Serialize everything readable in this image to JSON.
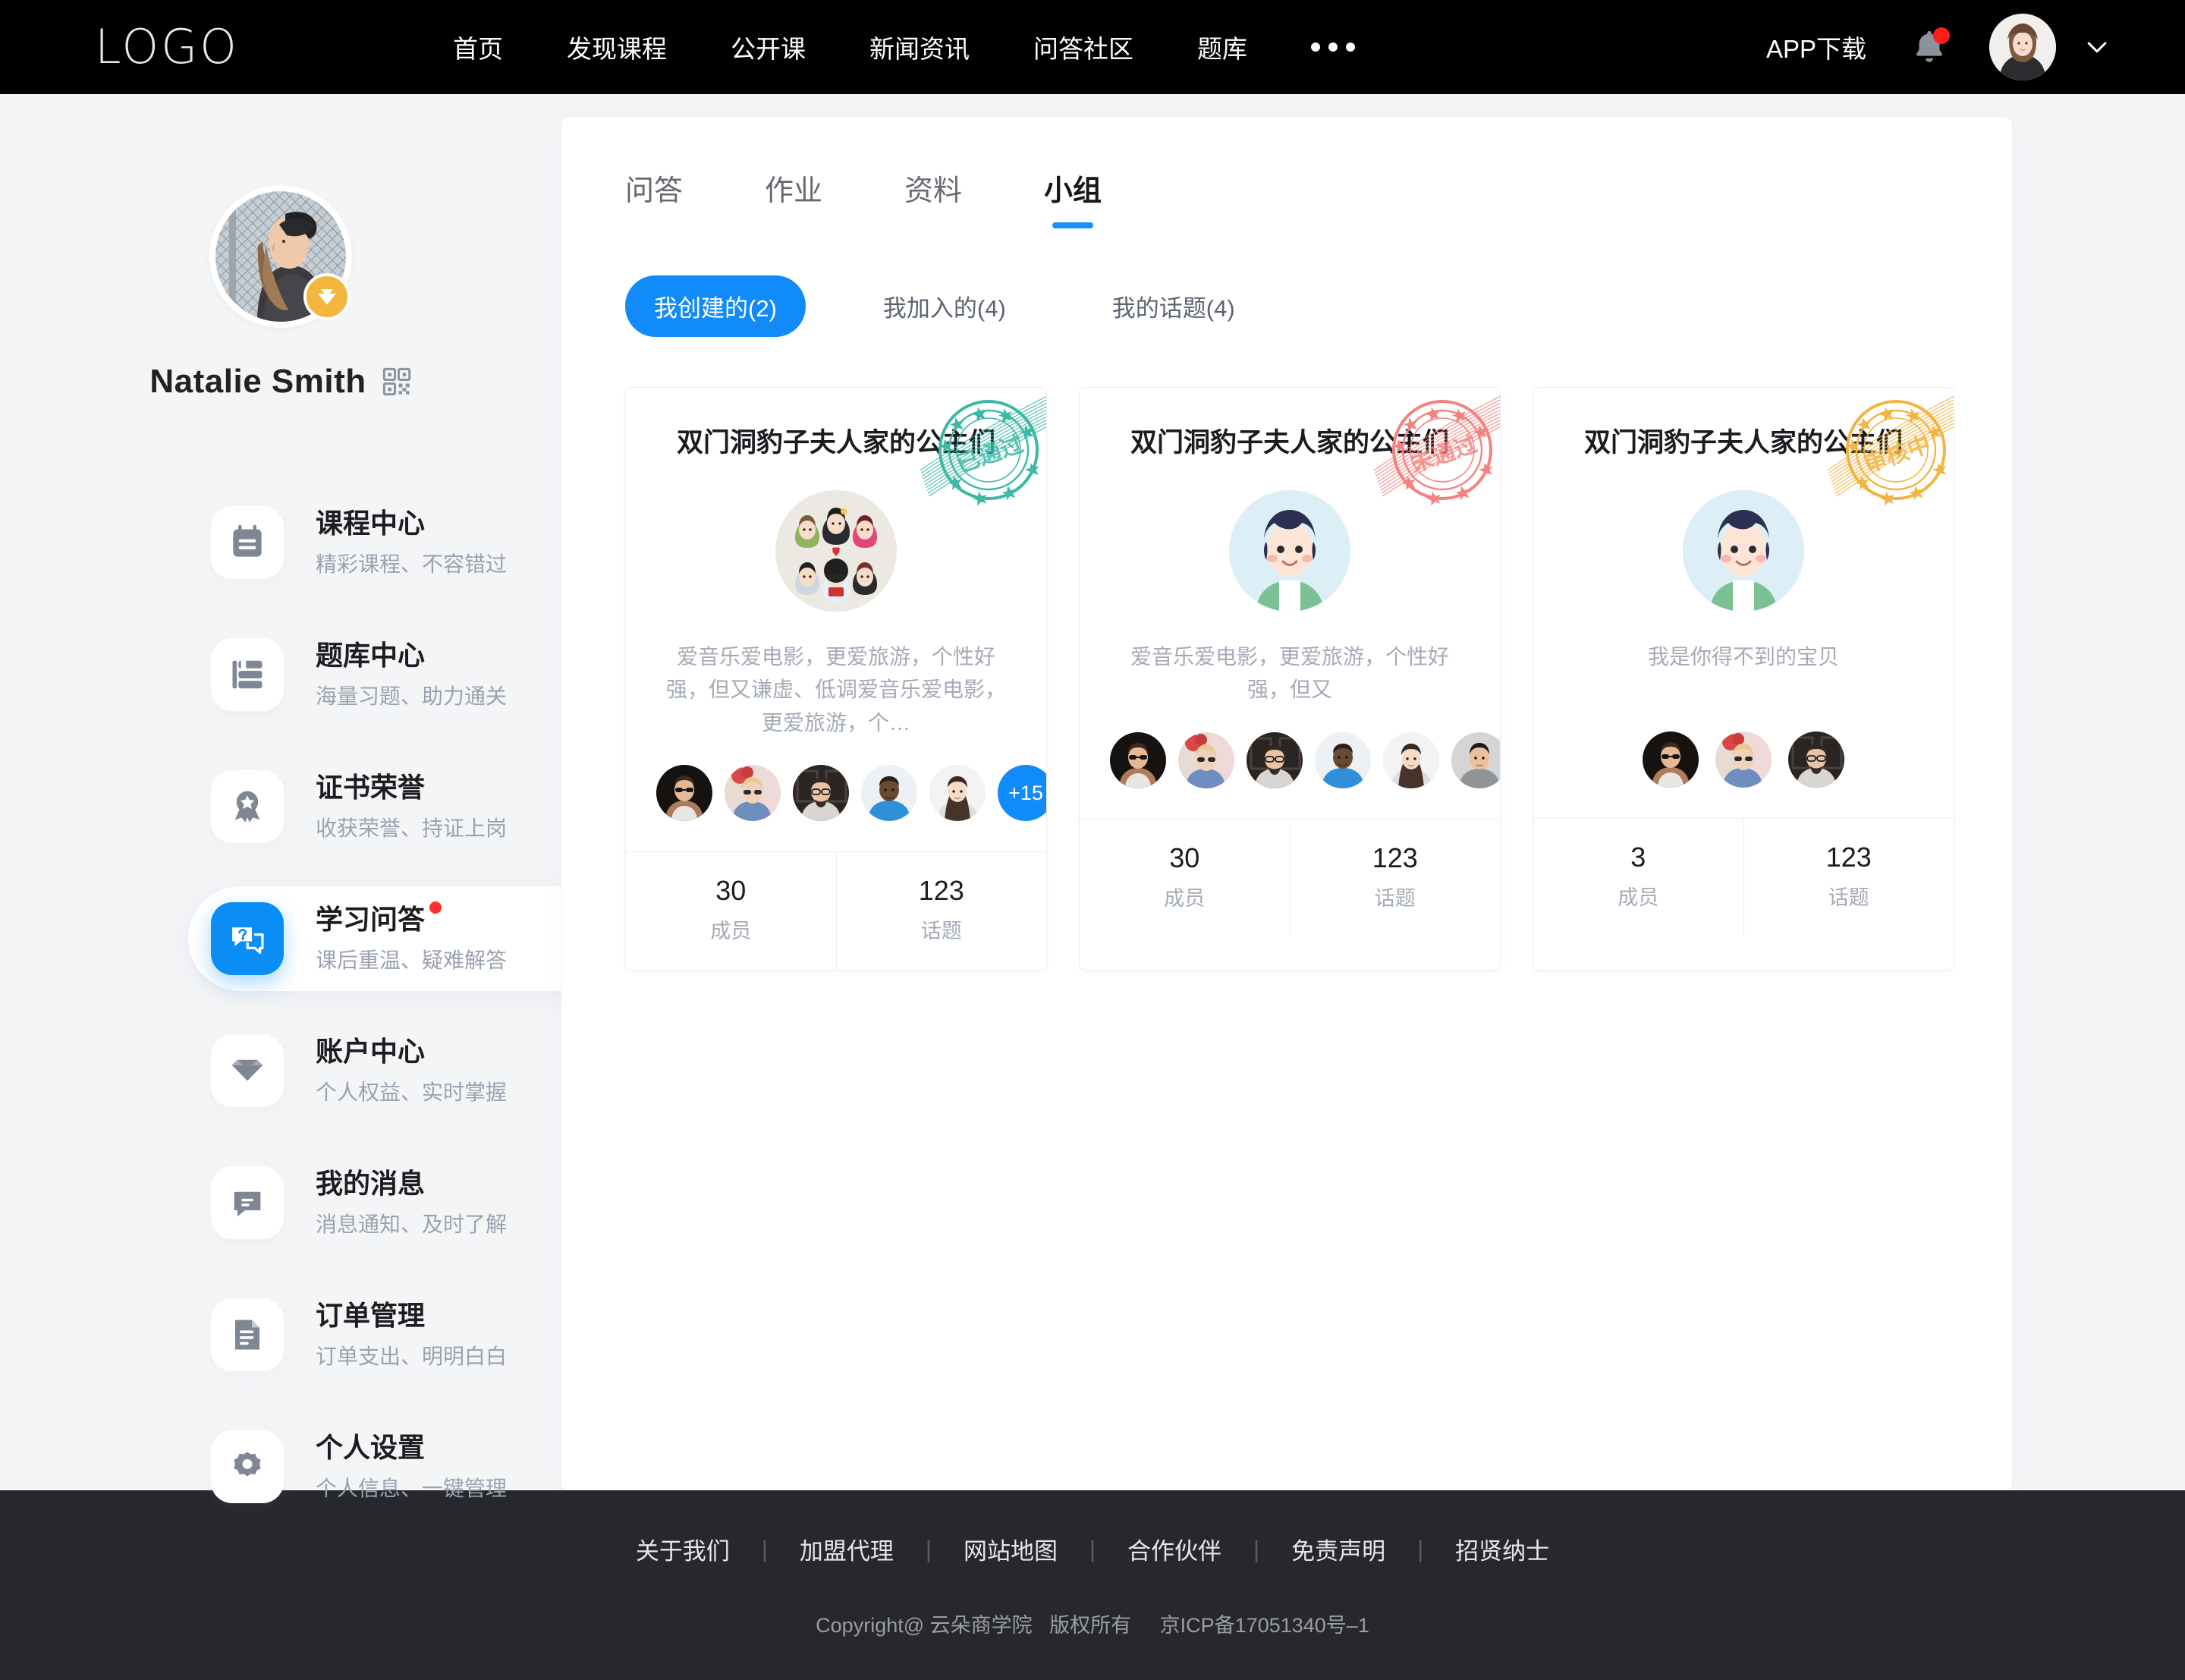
{
  "header": {
    "logo": "LOGO",
    "nav": [
      {
        "label": "首页"
      },
      {
        "label": "发现课程"
      },
      {
        "label": "公开课"
      },
      {
        "label": "新闻资讯"
      },
      {
        "label": "问答社区"
      },
      {
        "label": "题库"
      }
    ],
    "more_icon": "more-horizontal-icon",
    "app_download": "APP下载",
    "bell_icon": "bell-icon",
    "has_notification": true,
    "avatar_icon": "user-avatar",
    "chevron_icon": "chevron-down-icon"
  },
  "sidebar": {
    "user_name": "Natalie Smith",
    "qr_icon": "qr-code-icon",
    "vip_badge_icon": "diamond-icon",
    "items": [
      {
        "title": "课程中心",
        "sub": "精彩课程、不容错过",
        "icon": "calendar-icon",
        "active": false,
        "badge": false
      },
      {
        "title": "题库中心",
        "sub": "海量习题、助力通关",
        "icon": "book-icon",
        "active": false,
        "badge": false
      },
      {
        "title": "证书荣誉",
        "sub": "收获荣誉、持证上岗",
        "icon": "medal-icon",
        "active": false,
        "badge": false
      },
      {
        "title": "学习问答",
        "sub": "课后重温、疑难解答",
        "icon": "question-chat-icon",
        "active": true,
        "badge": true
      },
      {
        "title": "账户中心",
        "sub": "个人权益、实时掌握",
        "icon": "diamond-icon",
        "active": false,
        "badge": false
      },
      {
        "title": "我的消息",
        "sub": "消息通知、及时了解",
        "icon": "message-icon",
        "active": false,
        "badge": false
      },
      {
        "title": "订单管理",
        "sub": "订单支出、明明白白",
        "icon": "document-icon",
        "active": false,
        "badge": false
      },
      {
        "title": "个人设置",
        "sub": "个人信息、一键管理",
        "icon": "gear-icon",
        "active": false,
        "badge": false
      }
    ]
  },
  "main": {
    "tabs": [
      {
        "label": "问答",
        "active": false
      },
      {
        "label": "作业",
        "active": false
      },
      {
        "label": "资料",
        "active": false
      },
      {
        "label": "小组",
        "active": true
      }
    ],
    "filters": [
      {
        "label": "我创建的(2)",
        "active": true
      },
      {
        "label": "我加入的(4)",
        "active": false
      },
      {
        "label": "我的话题(4)",
        "active": false
      }
    ],
    "cards": [
      {
        "title": "双门洞豹子夫人家的公主们",
        "stamp_text": "已通过",
        "stamp_color": "#3bb8a6",
        "avatar": "group-collage-avatar",
        "desc": "爱音乐爱电影，更爱旅游，个性好强，但又谦虚、低调爱音乐爱电影，更爱旅游，个…",
        "member_avatars": 5,
        "more_label": "+15",
        "stats": [
          {
            "num": "30",
            "label": "成员"
          },
          {
            "num": "123",
            "label": "话题"
          }
        ]
      },
      {
        "title": "双门洞豹子夫人家的公主们",
        "stamp_text": "未通过",
        "stamp_color": "#f4837f",
        "avatar": "boy-cartoon-avatar",
        "desc": "爱音乐爱电影，更爱旅游，个性好强，但又",
        "member_avatars": 6,
        "more_label": "",
        "stats": [
          {
            "num": "30",
            "label": "成员"
          },
          {
            "num": "123",
            "label": "话题"
          }
        ]
      },
      {
        "title": "双门洞豹子夫人家的公主们",
        "stamp_text": "审核中",
        "stamp_color": "#f2b443",
        "avatar": "boy-cartoon-avatar",
        "desc": "我是你得不到的宝贝",
        "member_avatars": 3,
        "more_label": "",
        "stats": [
          {
            "num": "3",
            "label": "成员"
          },
          {
            "num": "123",
            "label": "话题"
          }
        ]
      }
    ]
  },
  "footer": {
    "links": [
      "关于我们",
      "加盟代理",
      "网站地图",
      "合作伙伴",
      "免责声明",
      "招贤纳士"
    ],
    "copyright": "Copyright@ 云朵商学院   版权所有     京ICP备17051340号–1"
  },
  "colors": {
    "accent": "#128bfa",
    "header_bg": "#000000",
    "page_bg": "#f4f5f7",
    "footer_bg": "#26282d"
  }
}
